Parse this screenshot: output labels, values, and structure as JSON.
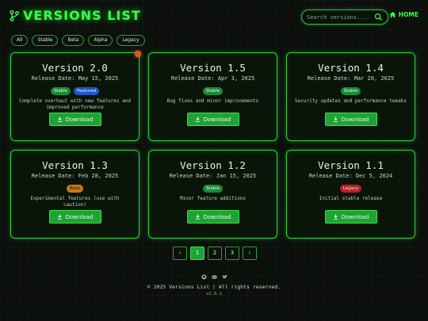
{
  "header": {
    "logo_icon": "branch-icon",
    "title": "VERSIONS LIST",
    "search_placeholder": "Search versions...",
    "home_label": "HOME"
  },
  "filters": [
    "All",
    "Stable",
    "Beta",
    "Alpha",
    "Legacy"
  ],
  "cards": [
    {
      "title": "Version 2.0",
      "date": "Release Date: May 15, 2025",
      "badges": [
        {
          "label": "Stable",
          "type": "stable"
        },
        {
          "label": "Featured",
          "type": "featured"
        }
      ],
      "description": "Complete overhaul with new features and improved performance",
      "download_label": "Download"
    },
    {
      "title": "Version 1.5",
      "date": "Release Date: Apr 3, 2025",
      "badges": [
        {
          "label": "Stable",
          "type": "stable"
        }
      ],
      "description": "Bug fixes and minor improvements",
      "download_label": "Download"
    },
    {
      "title": "Version 1.4",
      "date": "Release Date: Mar 20, 2025",
      "badges": [
        {
          "label": "Stable",
          "type": "stable"
        }
      ],
      "description": "Security updates and performance tweaks",
      "download_label": "Download"
    },
    {
      "title": "Version 1.3",
      "date": "Release Date: Feb 28, 2025",
      "badges": [
        {
          "label": "Beta",
          "type": "beta"
        }
      ],
      "description": "Experimental features (use with caution)",
      "download_label": "Download"
    },
    {
      "title": "Version 1.2",
      "date": "Release Date: Jan 15, 2025",
      "badges": [
        {
          "label": "Stable",
          "type": "stable"
        }
      ],
      "description": "Minor feature additions",
      "download_label": "Download"
    },
    {
      "title": "Version 1.1",
      "date": "Release Date: Dec 5, 2024",
      "badges": [
        {
          "label": "Legacy",
          "type": "legacy"
        }
      ],
      "description": "Initial stable release",
      "download_label": "Download"
    }
  ],
  "pagination": {
    "prev": "‹",
    "pages": [
      "1",
      "2",
      "3"
    ],
    "next": "›",
    "active": "1"
  },
  "footer": {
    "social_icons": [
      "github-icon",
      "discord-icon",
      "twitter-icon"
    ],
    "copyright": "© 2025 Versions List | All rights reserved.",
    "version": "v2.0.1"
  },
  "colors": {
    "accent": "#39ff4a",
    "button": "#1ea334",
    "stable": "#1a8a3a",
    "featured": "#1f56c8",
    "beta": "#c47a12",
    "legacy": "#b3202a"
  }
}
